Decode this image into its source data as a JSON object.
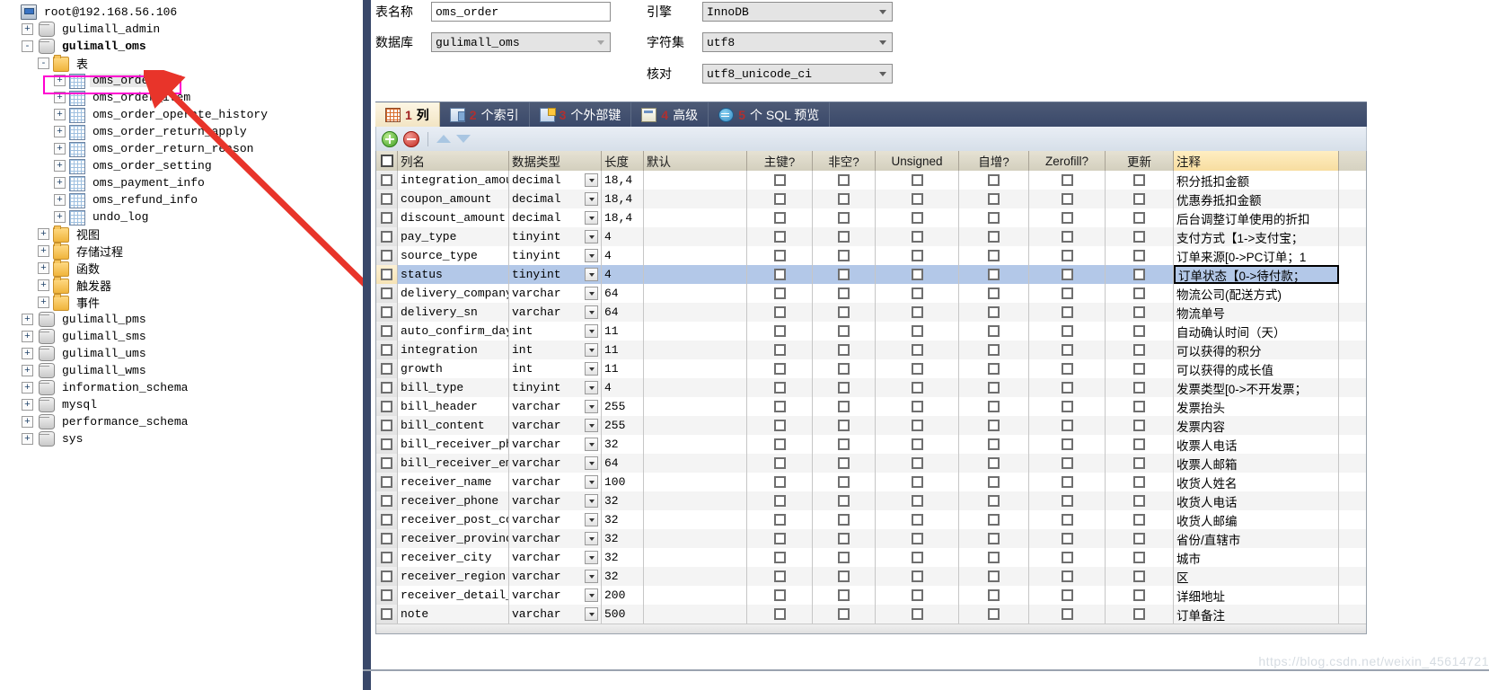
{
  "tree": {
    "root": "root@192.168.56.106",
    "nodes": [
      {
        "label": "root@192.168.56.106",
        "icon": "server-icon",
        "indent": 0,
        "expander": "none",
        "bold": false
      },
      {
        "label": "gulimall_admin",
        "icon": "database-icon",
        "indent": 1,
        "expander": "+",
        "bold": false
      },
      {
        "label": "gulimall_oms",
        "icon": "database-icon",
        "indent": 1,
        "expander": "-",
        "bold": true
      },
      {
        "label": "表",
        "icon": "folder-icon",
        "indent": 2,
        "expander": "-",
        "bold": false
      },
      {
        "label": "oms_order",
        "icon": "table-icon",
        "indent": 3,
        "expander": "+",
        "bold": false,
        "selected": true
      },
      {
        "label": "oms_order_item",
        "icon": "table-icon",
        "indent": 3,
        "expander": "+",
        "bold": false
      },
      {
        "label": "oms_order_operate_history",
        "icon": "table-icon",
        "indent": 3,
        "expander": "+",
        "bold": false
      },
      {
        "label": "oms_order_return_apply",
        "icon": "table-icon",
        "indent": 3,
        "expander": "+",
        "bold": false
      },
      {
        "label": "oms_order_return_reason",
        "icon": "table-icon",
        "indent": 3,
        "expander": "+",
        "bold": false
      },
      {
        "label": "oms_order_setting",
        "icon": "table-icon",
        "indent": 3,
        "expander": "+",
        "bold": false
      },
      {
        "label": "oms_payment_info",
        "icon": "table-icon",
        "indent": 3,
        "expander": "+",
        "bold": false
      },
      {
        "label": "oms_refund_info",
        "icon": "table-icon",
        "indent": 3,
        "expander": "+",
        "bold": false
      },
      {
        "label": "undo_log",
        "icon": "table-icon",
        "indent": 3,
        "expander": "+",
        "bold": false
      },
      {
        "label": "视图",
        "icon": "folder-icon",
        "indent": 2,
        "expander": "+",
        "bold": false
      },
      {
        "label": "存储过程",
        "icon": "folder-icon",
        "indent": 2,
        "expander": "+",
        "bold": false
      },
      {
        "label": "函数",
        "icon": "folder-icon",
        "indent": 2,
        "expander": "+",
        "bold": false
      },
      {
        "label": "触发器",
        "icon": "folder-icon",
        "indent": 2,
        "expander": "+",
        "bold": false
      },
      {
        "label": "事件",
        "icon": "folder-icon",
        "indent": 2,
        "expander": "+",
        "bold": false
      },
      {
        "label": "gulimall_pms",
        "icon": "database-icon",
        "indent": 1,
        "expander": "+",
        "bold": false
      },
      {
        "label": "gulimall_sms",
        "icon": "database-icon",
        "indent": 1,
        "expander": "+",
        "bold": false
      },
      {
        "label": "gulimall_ums",
        "icon": "database-icon",
        "indent": 1,
        "expander": "+",
        "bold": false
      },
      {
        "label": "gulimall_wms",
        "icon": "database-icon",
        "indent": 1,
        "expander": "+",
        "bold": false
      },
      {
        "label": "information_schema",
        "icon": "database-icon",
        "indent": 1,
        "expander": "+",
        "bold": false
      },
      {
        "label": "mysql",
        "icon": "database-icon",
        "indent": 1,
        "expander": "+",
        "bold": false
      },
      {
        "label": "performance_schema",
        "icon": "database-icon",
        "indent": 1,
        "expander": "+",
        "bold": false
      },
      {
        "label": "sys",
        "icon": "database-icon",
        "indent": 1,
        "expander": "+",
        "bold": false
      }
    ]
  },
  "form": {
    "table_name_label": "表名称",
    "table_name_value": "oms_order",
    "database_label": "数据库",
    "database_value": "gulimall_oms",
    "engine_label": "引擎",
    "engine_value": "InnoDB",
    "charset_label": "字符集",
    "charset_value": "utf8",
    "collation_label": "核对",
    "collation_value": "utf8_unicode_ci"
  },
  "tabs": [
    {
      "num": "1",
      "label": "列",
      "icon": "columns-grid-icon",
      "active": true
    },
    {
      "num": "2",
      "label": "个索引",
      "icon": "index-icon",
      "active": false
    },
    {
      "num": "3",
      "label": "个外部键",
      "icon": "foreign-key-icon",
      "active": false
    },
    {
      "num": "4",
      "label": "高级",
      "icon": "advanced-icon",
      "active": false
    },
    {
      "num": "5",
      "label": "个 SQL 预览",
      "icon": "sql-preview-icon",
      "active": false
    }
  ],
  "toolbar": {
    "add": "add-row-icon",
    "remove": "remove-row-icon",
    "move_up": "move-up-icon",
    "move_down": "move-down-icon"
  },
  "grid": {
    "headers": [
      "列名",
      "数据类型",
      "长度",
      "默认",
      "主键?",
      "非空?",
      "Unsigned",
      "自增?",
      "Zerofill?",
      "更新",
      "注释"
    ],
    "rows": [
      {
        "name": "integration_amount",
        "type": "decimal",
        "length": "18,4",
        "default": "",
        "pk": false,
        "nn": false,
        "unsigned": false,
        "ai": false,
        "zf": false,
        "upd": false,
        "comment": "积分抵扣金额",
        "selected": false
      },
      {
        "name": "coupon_amount",
        "type": "decimal",
        "length": "18,4",
        "default": "",
        "pk": false,
        "nn": false,
        "unsigned": false,
        "ai": false,
        "zf": false,
        "upd": false,
        "comment": "优惠券抵扣金额",
        "selected": false
      },
      {
        "name": "discount_amount",
        "type": "decimal",
        "length": "18,4",
        "default": "",
        "pk": false,
        "nn": false,
        "unsigned": false,
        "ai": false,
        "zf": false,
        "upd": false,
        "comment": "后台调整订单使用的折扣",
        "selected": false
      },
      {
        "name": "pay_type",
        "type": "tinyint",
        "length": "4",
        "default": "",
        "pk": false,
        "nn": false,
        "unsigned": false,
        "ai": false,
        "zf": false,
        "upd": false,
        "comment": "支付方式【1->支付宝；",
        "selected": false
      },
      {
        "name": "source_type",
        "type": "tinyint",
        "length": "4",
        "default": "",
        "pk": false,
        "nn": false,
        "unsigned": false,
        "ai": false,
        "zf": false,
        "upd": false,
        "comment": "订单来源[0->PC订单；1",
        "selected": false
      },
      {
        "name": "status",
        "type": "tinyint",
        "length": "4",
        "default": "",
        "pk": false,
        "nn": false,
        "unsigned": false,
        "ai": false,
        "zf": false,
        "upd": false,
        "comment": "订单状态【0->待付款；",
        "selected": true
      },
      {
        "name": "delivery_company",
        "type": "varchar",
        "length": "64",
        "default": "",
        "pk": false,
        "nn": false,
        "unsigned": false,
        "ai": false,
        "zf": false,
        "upd": false,
        "comment": "物流公司(配送方式)",
        "selected": false
      },
      {
        "name": "delivery_sn",
        "type": "varchar",
        "length": "64",
        "default": "",
        "pk": false,
        "nn": false,
        "unsigned": false,
        "ai": false,
        "zf": false,
        "upd": false,
        "comment": "物流单号",
        "selected": false
      },
      {
        "name": "auto_confirm_day",
        "type": "int",
        "length": "11",
        "default": "",
        "pk": false,
        "nn": false,
        "unsigned": false,
        "ai": false,
        "zf": false,
        "upd": false,
        "comment": "自动确认时间（天）",
        "selected": false
      },
      {
        "name": "integration",
        "type": "int",
        "length": "11",
        "default": "",
        "pk": false,
        "nn": false,
        "unsigned": false,
        "ai": false,
        "zf": false,
        "upd": false,
        "comment": "可以获得的积分",
        "selected": false
      },
      {
        "name": "growth",
        "type": "int",
        "length": "11",
        "default": "",
        "pk": false,
        "nn": false,
        "unsigned": false,
        "ai": false,
        "zf": false,
        "upd": false,
        "comment": "可以获得的成长值",
        "selected": false
      },
      {
        "name": "bill_type",
        "type": "tinyint",
        "length": "4",
        "default": "",
        "pk": false,
        "nn": false,
        "unsigned": false,
        "ai": false,
        "zf": false,
        "upd": false,
        "comment": "发票类型[0->不开发票；",
        "selected": false
      },
      {
        "name": "bill_header",
        "type": "varchar",
        "length": "255",
        "default": "",
        "pk": false,
        "nn": false,
        "unsigned": false,
        "ai": false,
        "zf": false,
        "upd": false,
        "comment": "发票抬头",
        "selected": false
      },
      {
        "name": "bill_content",
        "type": "varchar",
        "length": "255",
        "default": "",
        "pk": false,
        "nn": false,
        "unsigned": false,
        "ai": false,
        "zf": false,
        "upd": false,
        "comment": "发票内容",
        "selected": false
      },
      {
        "name": "bill_receiver_phone",
        "type": "varchar",
        "length": "32",
        "default": "",
        "pk": false,
        "nn": false,
        "unsigned": false,
        "ai": false,
        "zf": false,
        "upd": false,
        "comment": "收票人电话",
        "selected": false
      },
      {
        "name": "bill_receiver_email",
        "type": "varchar",
        "length": "64",
        "default": "",
        "pk": false,
        "nn": false,
        "unsigned": false,
        "ai": false,
        "zf": false,
        "upd": false,
        "comment": "收票人邮箱",
        "selected": false
      },
      {
        "name": "receiver_name",
        "type": "varchar",
        "length": "100",
        "default": "",
        "pk": false,
        "nn": false,
        "unsigned": false,
        "ai": false,
        "zf": false,
        "upd": false,
        "comment": "收货人姓名",
        "selected": false
      },
      {
        "name": "receiver_phone",
        "type": "varchar",
        "length": "32",
        "default": "",
        "pk": false,
        "nn": false,
        "unsigned": false,
        "ai": false,
        "zf": false,
        "upd": false,
        "comment": "收货人电话",
        "selected": false
      },
      {
        "name": "receiver_post_code",
        "type": "varchar",
        "length": "32",
        "default": "",
        "pk": false,
        "nn": false,
        "unsigned": false,
        "ai": false,
        "zf": false,
        "upd": false,
        "comment": "收货人邮编",
        "selected": false
      },
      {
        "name": "receiver_province",
        "type": "varchar",
        "length": "32",
        "default": "",
        "pk": false,
        "nn": false,
        "unsigned": false,
        "ai": false,
        "zf": false,
        "upd": false,
        "comment": "省份/直辖市",
        "selected": false
      },
      {
        "name": "receiver_city",
        "type": "varchar",
        "length": "32",
        "default": "",
        "pk": false,
        "nn": false,
        "unsigned": false,
        "ai": false,
        "zf": false,
        "upd": false,
        "comment": "城市",
        "selected": false
      },
      {
        "name": "receiver_region",
        "type": "varchar",
        "length": "32",
        "default": "",
        "pk": false,
        "nn": false,
        "unsigned": false,
        "ai": false,
        "zf": false,
        "upd": false,
        "comment": "区",
        "selected": false
      },
      {
        "name": "receiver_detail_address",
        "type": "varchar",
        "length": "200",
        "default": "",
        "pk": false,
        "nn": false,
        "unsigned": false,
        "ai": false,
        "zf": false,
        "upd": false,
        "comment": "详细地址",
        "selected": false
      },
      {
        "name": "note",
        "type": "varchar",
        "length": "500",
        "default": "",
        "pk": false,
        "nn": false,
        "unsigned": false,
        "ai": false,
        "zf": false,
        "upd": false,
        "comment": "订单备注",
        "selected": false
      }
    ]
  },
  "watermark": "https://blog.csdn.net/weixin_45614721"
}
